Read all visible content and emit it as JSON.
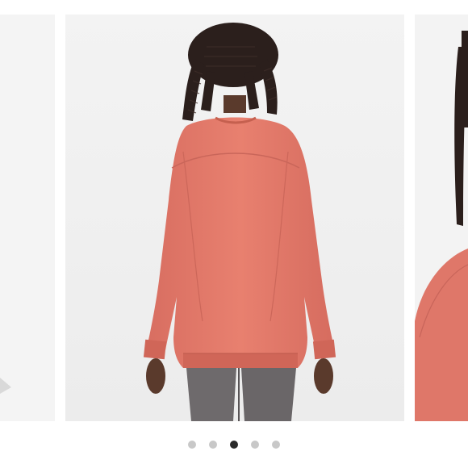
{
  "carousel": {
    "slide_count": 5,
    "active_index": 2,
    "colors": {
      "sweatshirt": "#e27a6c",
      "leggings": "#6e6a6c",
      "background": "#f1f1f1",
      "dot_inactive": "#c8c8c8",
      "dot_active": "#2a2a2a"
    },
    "images": {
      "previous": "sweatshirt-product-image",
      "current": "model-back-view-coral-sweatshirt",
      "next": "model-side-view-coral-sweatshirt"
    }
  }
}
